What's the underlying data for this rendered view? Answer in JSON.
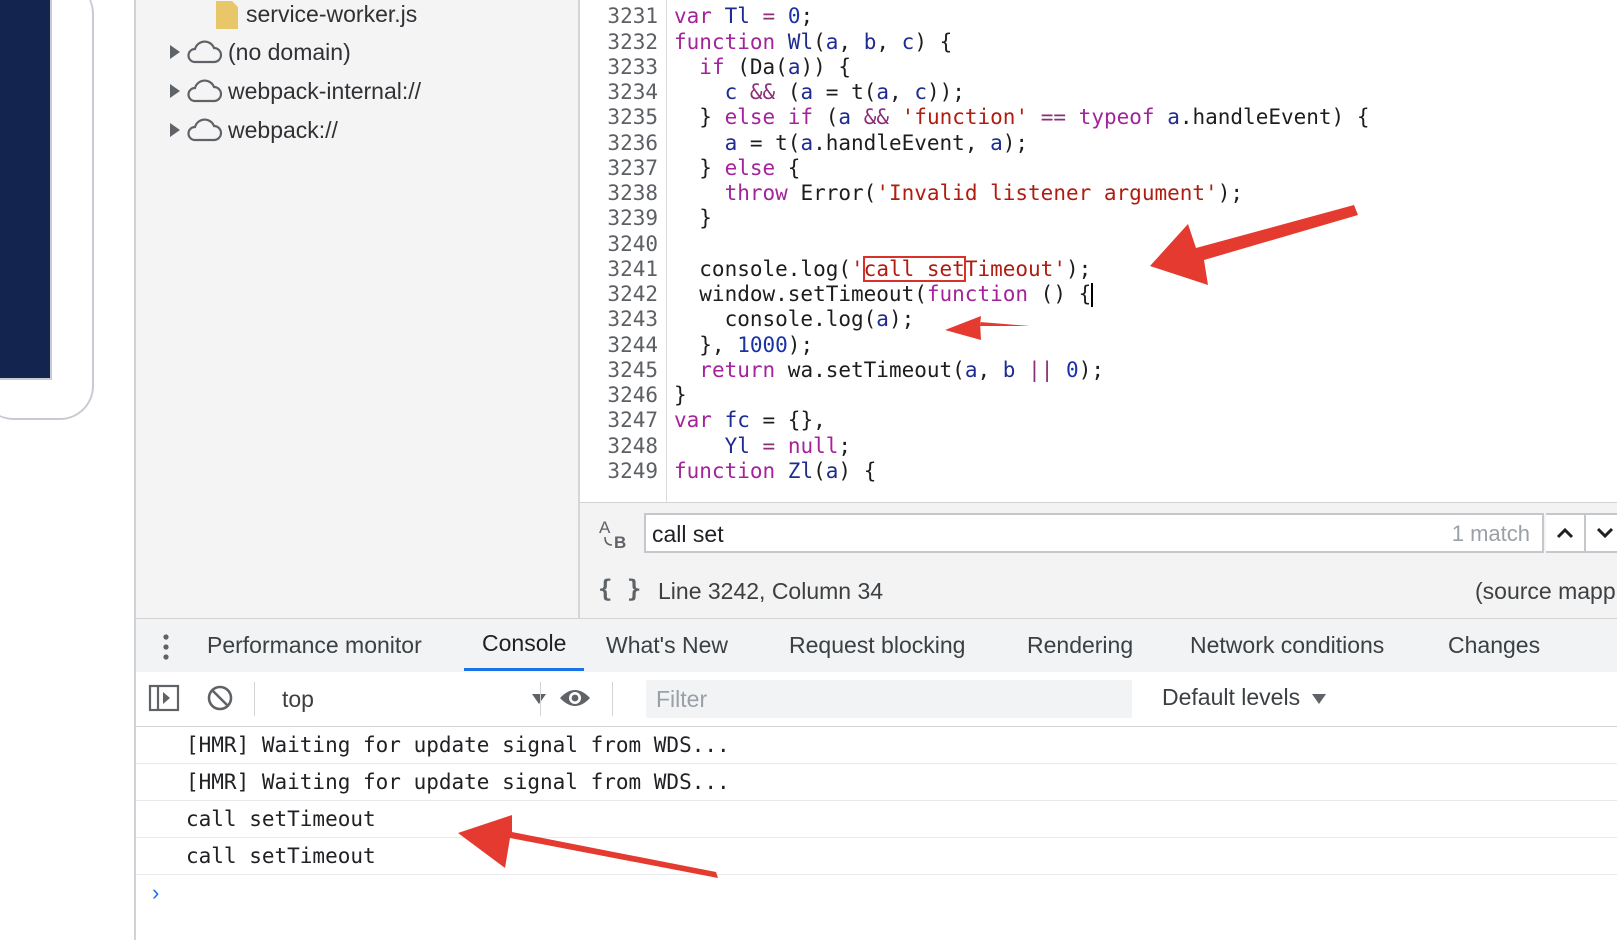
{
  "navigator": {
    "items": [
      {
        "label": "service-worker.js",
        "type": "file"
      },
      {
        "label": "(no domain)",
        "type": "domain"
      },
      {
        "label": "webpack-internal://",
        "type": "domain"
      },
      {
        "label": "webpack://",
        "type": "domain"
      }
    ]
  },
  "editor": {
    "lines": [
      {
        "n": "3231"
      },
      {
        "n": "3232"
      },
      {
        "n": "3233"
      },
      {
        "n": "3234"
      },
      {
        "n": "3235"
      },
      {
        "n": "3236"
      },
      {
        "n": "3237"
      },
      {
        "n": "3238"
      },
      {
        "n": "3239"
      },
      {
        "n": "3240"
      },
      {
        "n": "3241"
      },
      {
        "n": "3242"
      },
      {
        "n": "3243"
      },
      {
        "n": "3244"
      },
      {
        "n": "3245"
      },
      {
        "n": "3246"
      },
      {
        "n": "3247"
      },
      {
        "n": "3248"
      },
      {
        "n": "3249"
      }
    ],
    "code": {
      "l1": [
        "var ",
        "Tl",
        " = ",
        "0",
        ";"
      ],
      "l2": [
        "function ",
        "Wl",
        "(",
        "a",
        ", ",
        "b",
        ", ",
        "c",
        ") {"
      ],
      "l3": [
        "  ",
        "if",
        " (Da(",
        "a",
        ")) {"
      ],
      "l4": [
        "    ",
        "c",
        " ",
        "&&",
        " (",
        "a",
        " = t(",
        "a",
        ", ",
        "c",
        "));"
      ],
      "l5": [
        "  } ",
        "else if",
        " (",
        "a",
        " ",
        "&&",
        " ",
        "'function'",
        " == ",
        "typeof",
        " ",
        "a",
        ".handleEvent) {"
      ],
      "l6": [
        "    ",
        "a",
        " = t(",
        "a",
        ".handleEvent, ",
        "a",
        ");"
      ],
      "l7": [
        "  } ",
        "else",
        " {"
      ],
      "l8": [
        "    ",
        "throw",
        " Error(",
        "'Invalid listener argument'",
        ");"
      ],
      "l9": [
        "  }"
      ],
      "l10": [
        ""
      ],
      "l11": [
        "  console.log(",
        "'",
        "call set",
        "Timeout'",
        ");"
      ],
      "l12": [
        "  window.setTimeout(",
        "function",
        " () {"
      ],
      "l13": [
        "    console.log(",
        "a",
        ");"
      ],
      "l14": [
        "  }, ",
        "1000",
        ");"
      ],
      "l15": [
        "  ",
        "return",
        " wa.setTimeout(",
        "a",
        ", ",
        "b",
        " ",
        "||",
        " ",
        "0",
        ");"
      ],
      "l16": [
        "}"
      ],
      "l17": [
        "var ",
        "fc",
        " = {},"
      ],
      "l18": [
        "    ",
        "Yl",
        " = ",
        "null",
        ";"
      ],
      "l19": [
        "function ",
        "Zl",
        "(",
        "a",
        ") {"
      ]
    }
  },
  "search": {
    "case_icon": "Aa",
    "query": "call set",
    "match_count": "1 match"
  },
  "status": {
    "cursor": "Line 3242, Column 34",
    "source_map": "(source mapp"
  },
  "drawer": {
    "tabs": [
      {
        "label": "Performance monitor"
      },
      {
        "label": "Console"
      },
      {
        "label": "What's New"
      },
      {
        "label": "Request blocking"
      },
      {
        "label": "Rendering"
      },
      {
        "label": "Network conditions"
      },
      {
        "label": "Changes"
      }
    ],
    "active_tab": "Console"
  },
  "console": {
    "context": "top",
    "filter_placeholder": "Filter",
    "levels": "Default levels",
    "messages": [
      "[HMR] Waiting for update signal from WDS...",
      "[HMR] Waiting for update signal from WDS...",
      "call setTimeout",
      "call setTimeout"
    ],
    "prompt": "›"
  },
  "colors": {
    "accent": "#1a73e8",
    "annotation_arrow": "#e53a2f",
    "keyword": "#a4239b",
    "string": "#b01c10"
  }
}
